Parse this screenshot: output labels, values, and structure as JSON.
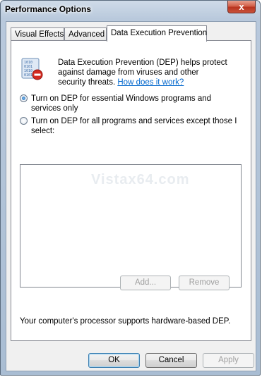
{
  "window": {
    "title": "Performance Options",
    "close_glyph": "x"
  },
  "tabs": [
    {
      "label": "Visual Effects"
    },
    {
      "label": "Advanced"
    },
    {
      "label": "Data Execution Prevention"
    }
  ],
  "dep": {
    "icon": "dep-shield-icon",
    "icon_text": [
      "1010",
      "0101",
      "1010",
      "0101"
    ],
    "description": "Data Execution Prevention (DEP) helps protect against damage from viruses and other security threats.",
    "link": "How does it work?",
    "option1": "Turn on DEP for essential Windows programs and services only",
    "option2": "Turn on DEP for all programs and services except those I select:",
    "selected_option": 1,
    "watermark": "Vistax64.com",
    "add_label": "Add...",
    "remove_label": "Remove",
    "support_text": "Your computer's processor supports hardware-based DEP."
  },
  "footer": {
    "ok_label": "OK",
    "cancel_label": "Cancel",
    "apply_label": "Apply"
  },
  "colors": {
    "link": "#0066cc",
    "title_gradient_top": "#cfdbe8",
    "close_red": "#c9533c"
  }
}
